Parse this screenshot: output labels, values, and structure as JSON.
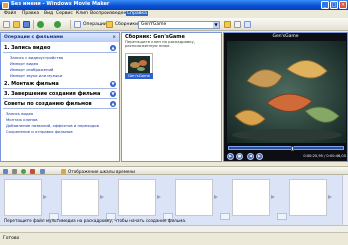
{
  "window": {
    "title": "Без имени - Windows Movie Maker"
  },
  "menu": {
    "items": [
      "Файл",
      "Правка",
      "Вид",
      "Сервис",
      "Клип",
      "Воспроизведение",
      "Справка"
    ],
    "active_index": 6
  },
  "toolbar": {
    "operations_label": "Операции",
    "collections_label": "Сборники",
    "collection_value": "GenYGame"
  },
  "tasks_pane": {
    "header": "Операции с фильмами",
    "close_glyph": "×",
    "sections": [
      {
        "title": "1. Запись видео",
        "links": [
          "Запись с видеоустройства",
          "Импорт видео",
          "Импорт изображений",
          "Импорт звука или музыки"
        ]
      },
      {
        "title": "2. Монтаж фильма",
        "links": []
      },
      {
        "title": "3. Завершение создания фильма",
        "links": []
      },
      {
        "title": "Советы по созданию фильмов",
        "links": [
          "Запись видео",
          "Монтаж клипов",
          "Добавление названий, эффектов и переходов",
          "Сохранение и отправка фильмов"
        ]
      }
    ]
  },
  "collection_pane": {
    "title": "Сборник: Gen'sGame",
    "subtitle": "Перетащите клип на раскадровку, расположенную ниже.",
    "clip_label": "Gen'sGame"
  },
  "preview": {
    "title": "Gen'sGame",
    "timecode": "0:00:25,95 / 0:00:46,05",
    "progress": 0.56,
    "controls": [
      "play-icon",
      "stop-icon",
      "prev-frame-icon",
      "next-frame-icon"
    ]
  },
  "timeline": {
    "label": "Отображение шкалы времени",
    "hint": "Перетащите файл мультимедиа на раскадровку, чтобы начать создание фильма."
  },
  "status": {
    "text": "Готово"
  },
  "colors": {
    "titlebar": "#0a4fd4",
    "link": "#15329e",
    "accent": "#3161cf"
  }
}
